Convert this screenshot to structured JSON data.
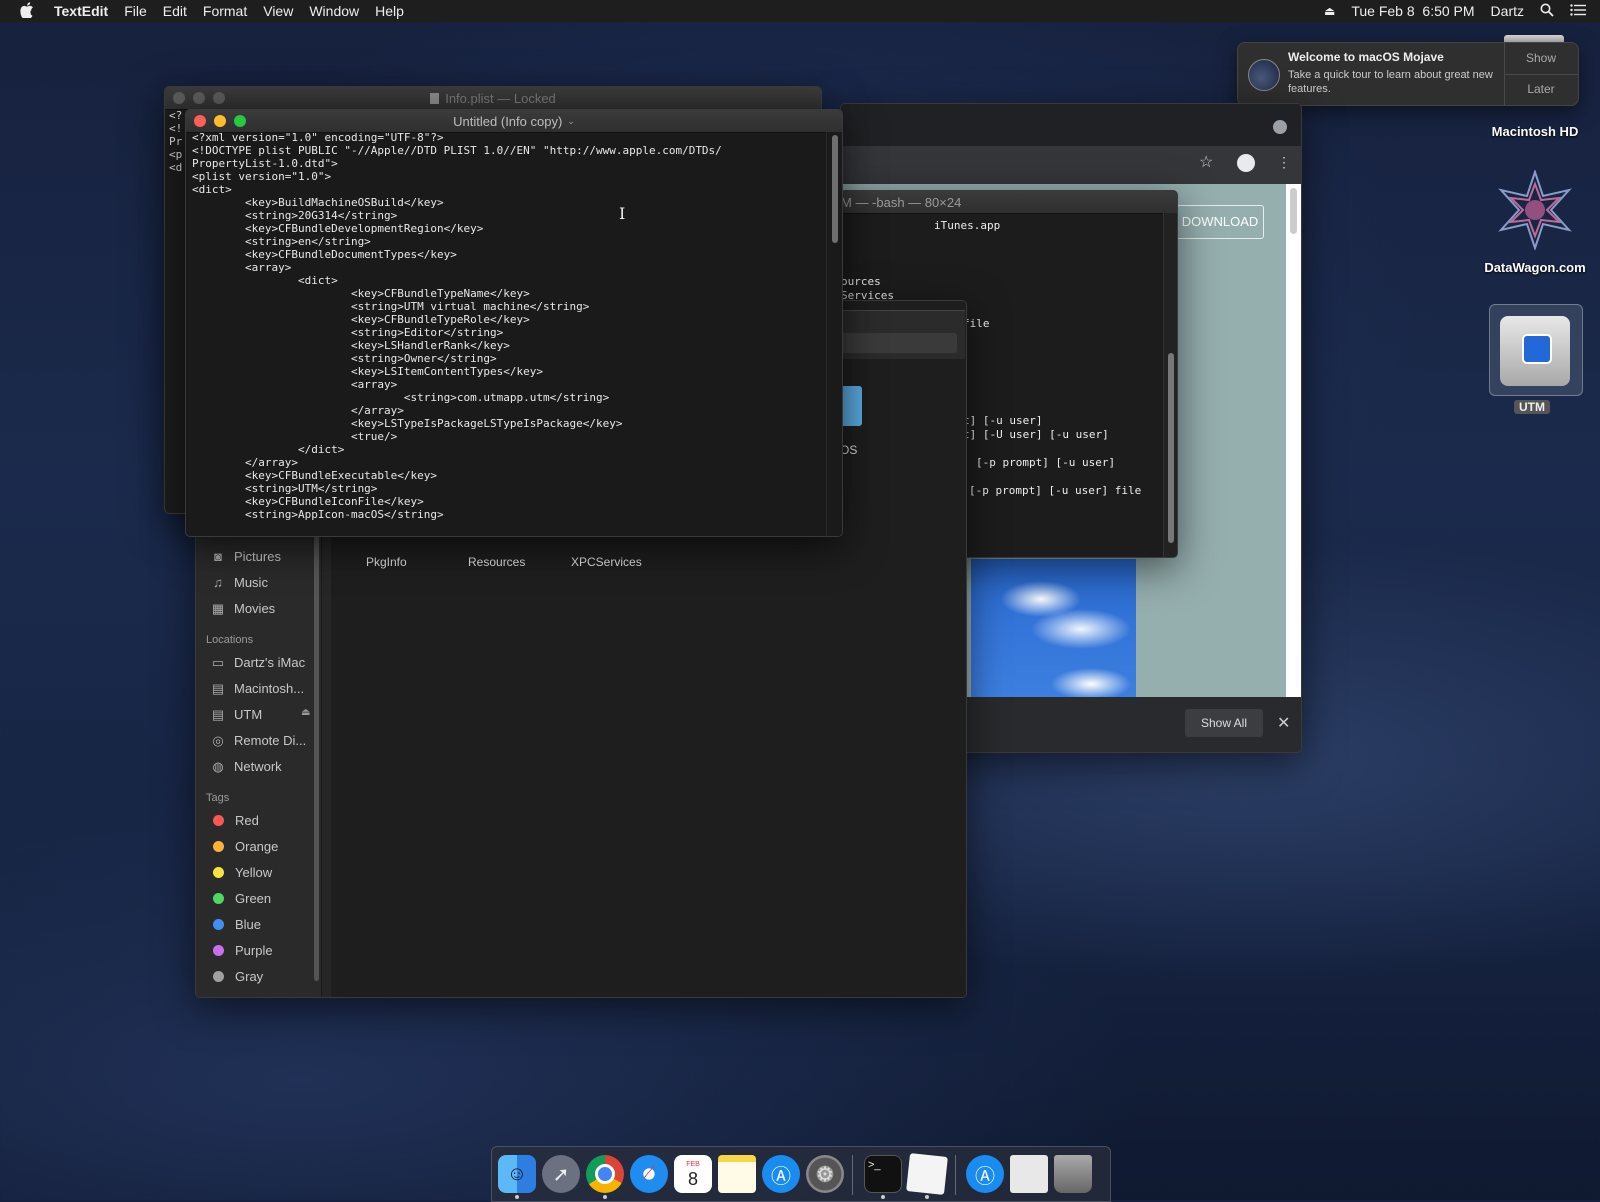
{
  "menubar": {
    "app_name": "TextEdit",
    "menus": [
      "File",
      "Edit",
      "Format",
      "View",
      "Window",
      "Help"
    ],
    "datetime": "Tue Feb 8  6:50 PM",
    "user": "Dartz"
  },
  "notification": {
    "title": "Welcome to macOS Mojave",
    "body": "Take a quick tour to learn about great new features.",
    "show_label": "Show",
    "later_label": "Later"
  },
  "desktop": {
    "items": [
      {
        "label": "Macintosh HD"
      },
      {
        "label": "DataWagon.com"
      },
      {
        "label": "UTM"
      }
    ]
  },
  "textedit_back": {
    "title": "Info.plist — Locked",
    "peek_lines": [
      "<?",
      "<!",
      "Pr",
      "<p",
      "<d"
    ]
  },
  "textedit_front": {
    "title": "Untitled (Info copy)",
    "content": "<?xml version=\"1.0\" encoding=\"UTF-8\"?>\n<!DOCTYPE plist PUBLIC \"-//Apple//DTD PLIST 1.0//EN\" \"http://www.apple.com/DTDs/\nPropertyList-1.0.dtd\">\n<plist version=\"1.0\">\n<dict>\n        <key>BuildMachineOSBuild</key>\n        <string>20G314</string>\n        <key>CFBundleDevelopmentRegion</key>\n        <string>en</string>\n        <key>CFBundleDocumentTypes</key>\n        <array>\n                <dict>\n                        <key>CFBundleTypeName</key>\n                        <string>UTM virtual machine</string>\n                        <key>CFBundleTypeRole</key>\n                        <string>Editor</string>\n                        <key>LSHandlerRank</key>\n                        <string>Owner</string>\n                        <key>LSItemContentTypes</key>\n                        <array>\n                                <string>com.utmapp.utm</string>\n                        </array>\n                        <key>LSTypeIsPackageLSTypeIsPackage</key>\n                        <true/>\n                </dict>\n        </array>\n        <key>CFBundleExecutable</key>\n        <string>UTM</string>\n        <key>CFBundleIconFile</key>\n        <string>AppIcon-macOS</string>"
  },
  "terminal": {
    "title": "M — -bash — 80×24",
    "lines": [
      {
        "text": "iTunes.app"
      },
      {
        "text": "ources"
      },
      {
        "text": "Services"
      },
      {
        "text": "deSignature"
      },
      {
        "text": "file"
      },
      {
        "text": "t] [-u user]"
      },
      {
        "text": "t] [-U user] [-u user]"
      },
      {
        "text": "[-p prompt] [-u user]"
      },
      {
        "text": "[-p prompt] [-u user] file"
      }
    ]
  },
  "chrome": {
    "download_label": "DOWNLOAD",
    "show_all_label": "Show All"
  },
  "finder": {
    "sidebar": {
      "favorites": [
        {
          "label": "Pictures",
          "icon": "camera-icon"
        },
        {
          "label": "Music",
          "icon": "music-note-icon"
        },
        {
          "label": "Movies",
          "icon": "film-icon"
        }
      ],
      "locations_title": "Locations",
      "locations": [
        {
          "label": "Dartz's iMac",
          "icon": "imac-icon"
        },
        {
          "label": "Macintosh...",
          "icon": "disk-icon"
        },
        {
          "label": "UTM",
          "icon": "disk-icon"
        },
        {
          "label": "Remote Di...",
          "icon": "remote-disc-icon"
        },
        {
          "label": "Network",
          "icon": "network-globe-icon"
        }
      ],
      "tags_title": "Tags",
      "tags": [
        {
          "label": "Red",
          "color": "#fc5753"
        },
        {
          "label": "Orange",
          "color": "#fdb13c"
        },
        {
          "label": "Yellow",
          "color": "#fce13f"
        },
        {
          "label": "Green",
          "color": "#4cd964"
        },
        {
          "label": "Blue",
          "color": "#3e90f7"
        },
        {
          "label": "Purple",
          "color": "#c86ff0"
        },
        {
          "label": "Gray",
          "color": "#a0a0a0"
        }
      ]
    },
    "files": [
      {
        "label": "PkgInfo"
      },
      {
        "label": "Resources"
      },
      {
        "label": "XPCServices"
      }
    ],
    "partial_label": "OS"
  },
  "dock": {
    "apps": [
      "Finder",
      "Launchpad",
      "Chrome",
      "Safari",
      "Calendar",
      "Notes",
      "App Store",
      "System Preferences",
      "Terminal",
      "TextEdit",
      "App Store",
      "Document",
      "Trash"
    ],
    "calendar_month": "FEB",
    "calendar_day": "8"
  }
}
